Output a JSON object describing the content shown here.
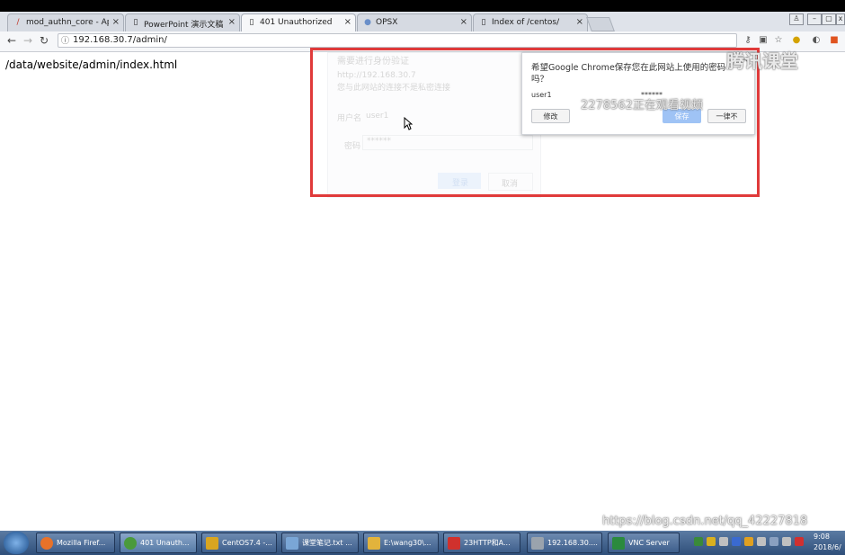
{
  "tabs": [
    {
      "title": "mod_authn_core - Apa",
      "icon": "feather-icon"
    },
    {
      "title": "PowerPoint 演示文稿",
      "icon": "page-icon"
    },
    {
      "title": "401 Unauthorized",
      "icon": "page-icon"
    },
    {
      "title": "OPSX",
      "icon": "globe-icon"
    },
    {
      "title": "Index of /centos/",
      "icon": "page-icon"
    }
  ],
  "tab_close_glyph": "×",
  "address": {
    "url": "192.168.30.7/admin/"
  },
  "page": {
    "path_text": "/data/website/admin/index.html"
  },
  "auth_dialog": {
    "title": "需要进行身份验证",
    "server": "http://192.168.30.7",
    "note": "您与此网站的连接不是私密连接",
    "user_label": "用户名",
    "user_value": "user1",
    "pass_label": "密码",
    "pass_value": "******",
    "login_label": "登录",
    "cancel_label": "取消"
  },
  "save_bubble": {
    "title_line1": "希望Google Chrome保存您在此网站上使用的密码",
    "title_line2": "吗？",
    "username": "user1",
    "password": "******",
    "edit_label": "修改",
    "save_label": "保存",
    "never_label": "一律不",
    "close_glyph": "×"
  },
  "watermarks": {
    "brand": "腾讯课堂",
    "viewer": "2278562正在观看视频",
    "blog": "https://blog.csdn.net/qq_42227818"
  },
  "taskbar": {
    "items": [
      {
        "label": "Mozilla Firef...",
        "color": "#e8722a"
      },
      {
        "label": "401 Unauth...",
        "color": "#4a9a3c"
      },
      {
        "label": "CentOS7.4 -...",
        "color": "#d9a520"
      },
      {
        "label": "课堂笔记.txt ...",
        "color": "#7aa6d6"
      },
      {
        "label": "E:\\wang30\\...",
        "color": "#e2b33c"
      },
      {
        "label": "23HTTP和A...",
        "color": "#d0312d"
      },
      {
        "label": "192.168.30....",
        "color": "#9aa3ad"
      },
      {
        "label": "VNC Server",
        "color": "#2b8a3e"
      }
    ],
    "clock_time": "9:08",
    "clock_date": "2018/6/"
  }
}
